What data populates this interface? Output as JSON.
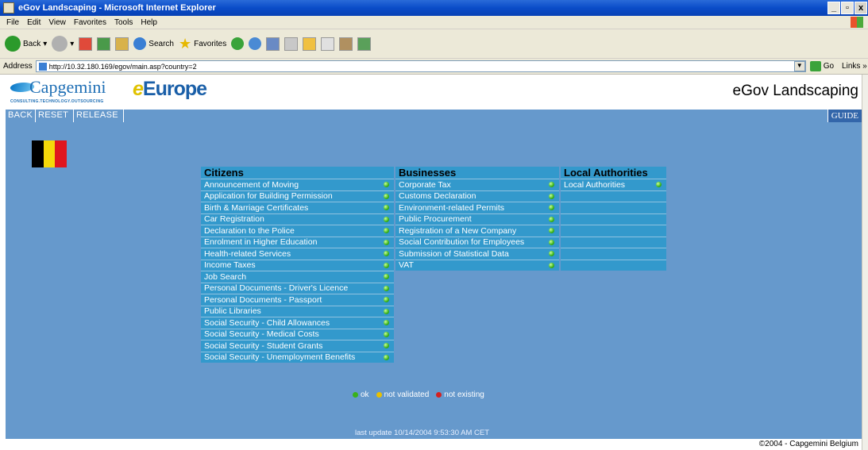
{
  "window": {
    "title": "eGov Landscaping - Microsoft Internet Explorer",
    "buttons": [
      "_",
      " ",
      "x"
    ]
  },
  "menu": [
    "File",
    "Edit",
    "View",
    "Favorites",
    "Tools",
    "Help"
  ],
  "toolbar": {
    "back": "Back",
    "search": "Search",
    "favorites": "Favorites"
  },
  "address": {
    "label": "Address",
    "url": "http://10.32.180.169/egov/main.asp?country=2",
    "go": "Go",
    "links": "Links"
  },
  "header": {
    "logo_word": "Capgemini",
    "logo_tagline": "CONSULTING.TECHNOLOGY.OUTSOURCING",
    "europe": "Europe",
    "title": "eGov Landscaping"
  },
  "nav": {
    "back": "BACK",
    "reset": "RESET",
    "release": "RELEASE",
    "guide": "GUIDE"
  },
  "flag_colors": [
    "#000000",
    "#f5d90a",
    "#e0161e"
  ],
  "citizens": {
    "header": "Citizens",
    "items": [
      "Announcement of Moving",
      "Application for Building Permission",
      "Birth & Marriage Certificates",
      "Car Registration",
      "Declaration to the Police",
      "Enrolment in Higher Education",
      "Health-related Services",
      "Income Taxes",
      "Job Search",
      "Personal Documents - Driver's Licence",
      "Personal Documents - Passport",
      "Public Libraries",
      "Social Security - Child Allowances",
      "Social Security - Medical Costs",
      "Social Security - Student Grants",
      "Social Security - Unemployment Benefits"
    ]
  },
  "businesses": {
    "header": "Businesses",
    "items": [
      "Corporate Tax",
      "Customs Declaration",
      "Environment-related Permits",
      "Public Procurement",
      "Registration of a New Company",
      "Social Contribution for Employees",
      "Submission of Statistical Data",
      "VAT"
    ]
  },
  "local": {
    "header": "Local Authorities",
    "items": [
      "Local Authorities"
    ]
  },
  "legend": {
    "ok": "ok",
    "not_validated": "not validated",
    "not_existing": "not existing"
  },
  "status_colors": {
    "ok": "#39b219",
    "not_validated": "#e8c000",
    "not_existing": "#d42020"
  },
  "last_update": "last update 10/14/2004 9:53:30 AM CET",
  "footer": "©2004 - Capgemini Belgium"
}
